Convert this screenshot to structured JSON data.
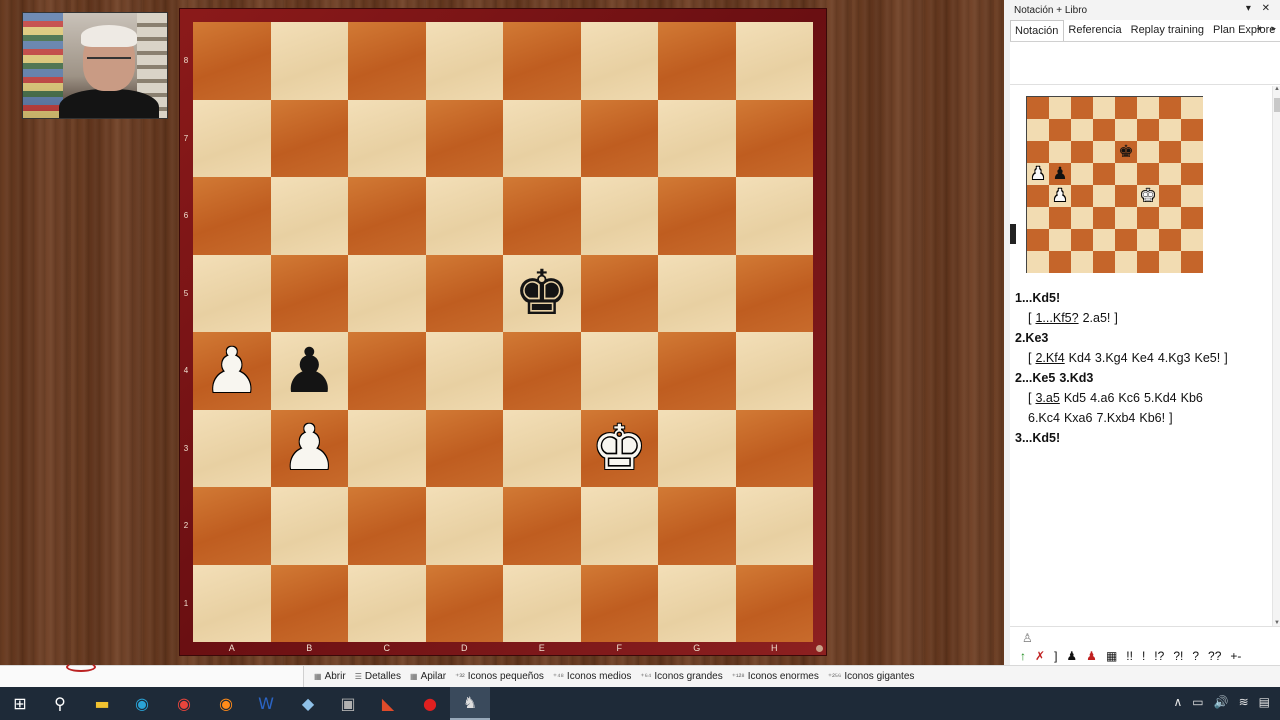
{
  "board": {
    "rank_labels": [
      "8",
      "7",
      "6",
      "5",
      "4",
      "3",
      "2",
      "1"
    ],
    "file_labels": [
      "A",
      "B",
      "C",
      "D",
      "E",
      "F",
      "G",
      "H"
    ],
    "pieces": [
      {
        "square": "e5",
        "color": "b",
        "glyph": "♚",
        "name": "black-king"
      },
      {
        "square": "a4",
        "color": "w",
        "glyph": "♟",
        "name": "white-pawn"
      },
      {
        "square": "b4",
        "color": "b",
        "glyph": "♟",
        "name": "black-pawn"
      },
      {
        "square": "b3",
        "color": "w",
        "glyph": "♟",
        "name": "white-pawn"
      },
      {
        "square": "f3",
        "color": "w",
        "glyph": "♚",
        "name": "white-king"
      }
    ]
  },
  "mini_board": {
    "pieces": [
      {
        "square": "e6",
        "color": "b",
        "glyph": "♚"
      },
      {
        "square": "a5",
        "color": "w",
        "glyph": "♟"
      },
      {
        "square": "b5",
        "color": "b",
        "glyph": "♟"
      },
      {
        "square": "b4",
        "color": "w",
        "glyph": "♟"
      },
      {
        "square": "f4",
        "color": "w",
        "glyph": "♚"
      }
    ]
  },
  "panel": {
    "title": "Notación + Libro",
    "header_controls": "▾ ✕",
    "tabs": [
      "Notación",
      "Referencia",
      "Replay training",
      "Plan Explore"
    ],
    "tab_arrows": "◂ ▸",
    "notation": [
      {
        "type": "main",
        "tokens": [
          {
            "t": "1...Kd5!"
          }
        ]
      },
      {
        "type": "var",
        "tokens": [
          {
            "t": "["
          },
          {
            "t": "1...Kf5?",
            "u": true
          },
          {
            "t": "2.a5!"
          },
          {
            "t": "]"
          }
        ]
      },
      {
        "type": "main",
        "tokens": [
          {
            "t": "2.Ke3"
          }
        ]
      },
      {
        "type": "var",
        "tokens": [
          {
            "t": "["
          },
          {
            "t": "2.Kf4",
            "u": true
          },
          {
            "t": "Kd4"
          },
          {
            "t": "3.Kg4"
          },
          {
            "t": "Ke4"
          },
          {
            "t": "4.Kg3"
          },
          {
            "t": "Ke5!"
          },
          {
            "t": "]"
          }
        ]
      },
      {
        "type": "main",
        "tokens": [
          {
            "t": "2...Ke5"
          },
          {
            "t": "3.Kd3"
          }
        ]
      },
      {
        "type": "var",
        "tokens": [
          {
            "t": "["
          },
          {
            "t": "3.a5",
            "u": true
          },
          {
            "t": "Kd5"
          },
          {
            "t": "4.a6"
          },
          {
            "t": "Kc6"
          },
          {
            "t": "5.Kd4"
          },
          {
            "t": "Kb6"
          }
        ]
      },
      {
        "type": "var",
        "tokens": [
          {
            "t": "6.Kc4"
          },
          {
            "t": "Kxa6"
          },
          {
            "t": "7.Kxb4"
          },
          {
            "t": "Kb6!"
          },
          {
            "t": "]"
          }
        ]
      },
      {
        "type": "main",
        "tokens": [
          {
            "t": "3...Kd5!"
          }
        ]
      }
    ],
    "symbols": [
      "↑",
      "✗",
      "]",
      "♟",
      "♟",
      "▦",
      "!!",
      "!",
      "!?",
      "?!",
      "?",
      "??",
      "+-"
    ]
  },
  "explorer_strip": {
    "items": [
      {
        "icon": "▦",
        "label": "Abrir"
      },
      {
        "icon": "☰",
        "label": "Detalles"
      },
      {
        "icon": "▦",
        "label": "Apilar"
      },
      {
        "icon": "⁺³²",
        "label": "Iconos pequeños"
      },
      {
        "icon": "⁺⁴⁸",
        "label": "Iconos medios"
      },
      {
        "icon": "⁺⁶⁴",
        "label": "Iconos grandes"
      },
      {
        "icon": "⁺¹²⁸",
        "label": "Iconos enormes"
      },
      {
        "icon": "⁺²⁵⁶",
        "label": "Iconos gigantes"
      }
    ]
  },
  "taskbar": {
    "apps": [
      {
        "name": "start",
        "glyph": "⊞",
        "color": "#ffffff"
      },
      {
        "name": "search",
        "glyph": "⚲",
        "color": "#ffffff"
      },
      {
        "name": "file-explorer",
        "glyph": "▬",
        "color": "#f2c230"
      },
      {
        "name": "edge",
        "glyph": "◉",
        "color": "#2aa3d6"
      },
      {
        "name": "chrome",
        "glyph": "◉",
        "color": "#e8453c"
      },
      {
        "name": "firefox",
        "glyph": "◉",
        "color": "#ff8b1a"
      },
      {
        "name": "word",
        "glyph": "W",
        "color": "#2b64c4"
      },
      {
        "name": "app-blue",
        "glyph": "◆",
        "color": "#8fc1e8"
      },
      {
        "name": "app-gray",
        "glyph": "▣",
        "color": "#b0b0b0"
      },
      {
        "name": "app-red",
        "glyph": "◣",
        "color": "#e04b2a"
      },
      {
        "name": "recorder",
        "glyph": "●",
        "color": "#e02020"
      },
      {
        "name": "chess-app",
        "glyph": "♞",
        "color": "#dddddd"
      }
    ],
    "tray": [
      "∧",
      "▭",
      "🔊",
      "≋",
      "▤"
    ]
  }
}
